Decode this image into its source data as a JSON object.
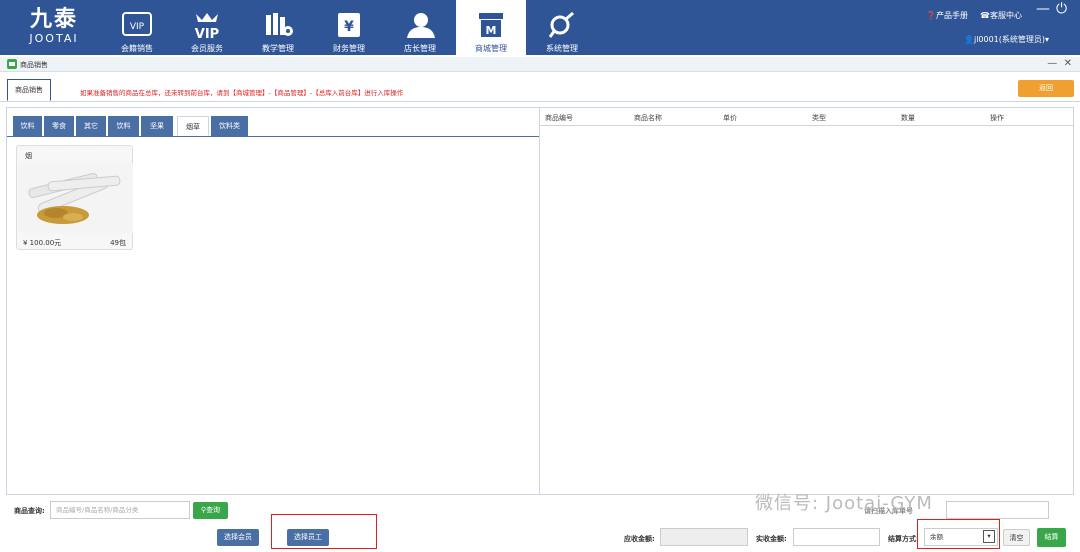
{
  "app": {
    "logo_cn": "九泰",
    "logo_en": "JOOTAI",
    "nav": [
      {
        "label": "会籍销售",
        "icon": "vip-card-icon"
      },
      {
        "label": "会员服务",
        "icon": "vip-crown-icon"
      },
      {
        "label": "教学管理",
        "icon": "books-gear-icon"
      },
      {
        "label": "财务管理",
        "icon": "yen-ledger-icon"
      },
      {
        "label": "店长管理",
        "icon": "manager-person-icon"
      },
      {
        "label": "商城管理",
        "icon": "store-icon"
      },
      {
        "label": "系统管理",
        "icon": "tools-icon"
      }
    ],
    "active_nav": 5,
    "help": "产品手册",
    "service": "客服中心",
    "user": "jl0001(系统管理员)",
    "colors": {
      "primary": "#2f5597",
      "accent": "#f0a030",
      "green": "#3aa64a",
      "red": "#e02020"
    }
  },
  "window": {
    "title": "商品销售"
  },
  "page": {
    "tab": "商品销售",
    "notice": "如果准备销售的商品在总库，还未转到前台库，请到【商城管理】-【商品管理】-【总库入前台库】进行入库操作",
    "back": "返回"
  },
  "categories": [
    "饮料",
    "零食",
    "其它",
    "饮料",
    "坚果",
    "烟草",
    "饮料类"
  ],
  "active_category": 5,
  "products": [
    {
      "name": "烟",
      "price": "¥ 100.00元",
      "stock": "49包"
    }
  ],
  "table": {
    "headers": [
      "商品编号",
      "商品名称",
      "单价",
      "类型",
      "数量",
      "操作"
    ]
  },
  "search": {
    "label": "商品查询:",
    "placeholder": "商品编号/商品名称/商品分类",
    "button": "查询"
  },
  "footer": {
    "select_member": "选择会员",
    "select_staff": "选择员工",
    "due_label": "应收金额:",
    "paid_label": "实收金额:",
    "method_label": "结算方式:",
    "method_value": "余额",
    "clear": "清空",
    "checkout": "结算",
    "hidden_label": "请扫描入库单号"
  },
  "watermark": "微信号: Jootai-GYM"
}
